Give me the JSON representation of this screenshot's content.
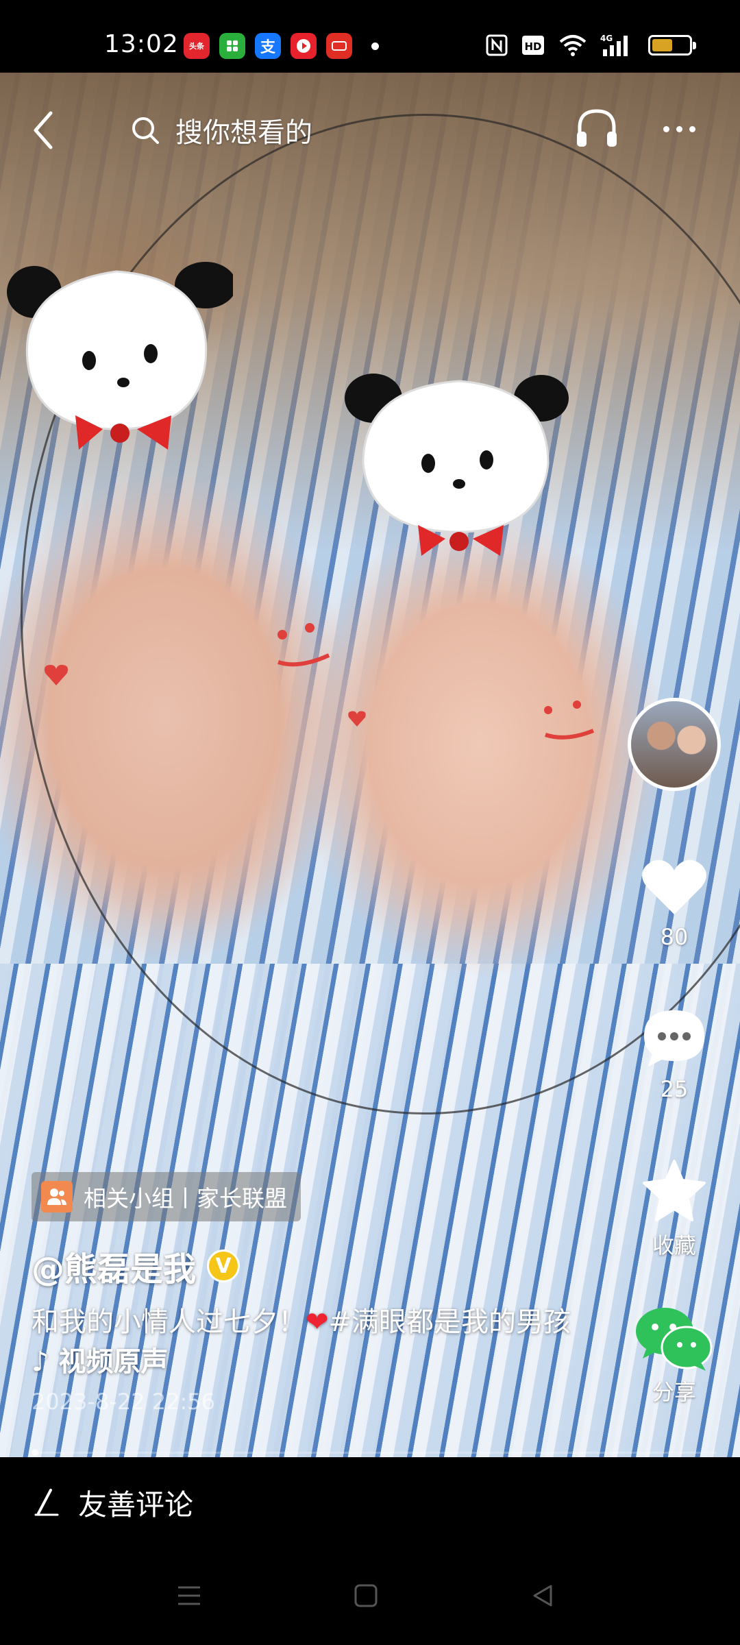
{
  "status": {
    "time": "13:02",
    "apps": [
      {
        "name": "toutiao-icon",
        "text": "头条",
        "color": "#e3262d"
      },
      {
        "name": "wechat-mini-icon",
        "text": "",
        "color": "#2aae3c"
      },
      {
        "name": "alipay-icon",
        "text": "支",
        "color": "#1677ff"
      },
      {
        "name": "video-app-icon",
        "text": "▶",
        "color": "#e8222c"
      },
      {
        "name": "pinduoduo-icon",
        "text": "",
        "color": "#e02e24"
      }
    ],
    "network": "4G",
    "hd": "HD",
    "battery_level": 0.55,
    "battery_color": "#d8a322"
  },
  "top": {
    "search_placeholder": "搜你想看的"
  },
  "actions": {
    "like_count": "80",
    "comment_count": "25",
    "favorite_label": "收藏",
    "share_label": "分享"
  },
  "post": {
    "group_tag": "相关小组丨家长联盟",
    "username": "@熊磊是我",
    "verified_badge": "V",
    "caption_part1": "和我的小情人过七夕！",
    "caption_heart": "❤",
    "caption_part2": "#满眼都是我的男孩",
    "caption_music": "♪ 视频原声",
    "date": "2023-8-22 22:56"
  },
  "comment_bar": {
    "placeholder": "友善评论"
  },
  "colors": {
    "accent_like": "#ffffff",
    "share_green": "#2fc25b",
    "group_orange": "#f28a4f",
    "verified_yellow": "#f5c518"
  }
}
